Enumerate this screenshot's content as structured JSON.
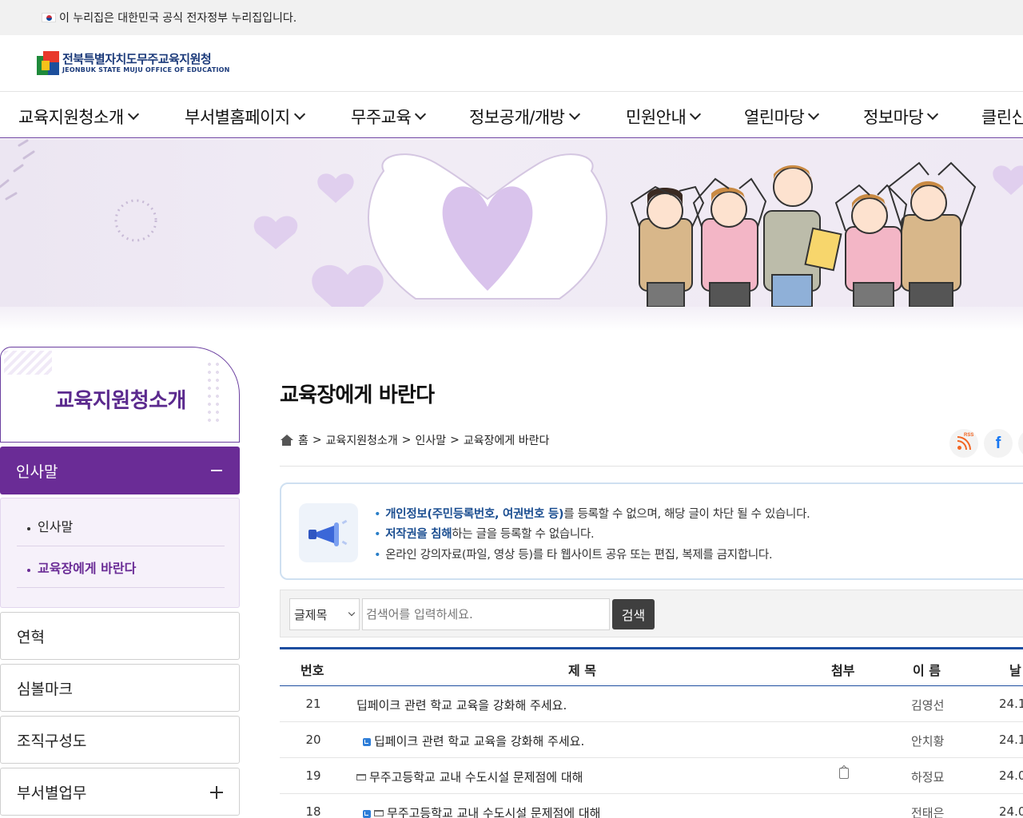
{
  "gov_banner": {
    "text": "이 누리집은 대한민국 공식 전자정부 누리집입니다."
  },
  "logo": {
    "name_ko": "전북특별자치도무주교육지원청",
    "name_en": "JEONBUK STATE MUJU OFFICE OF EDUCATION"
  },
  "gnb": [
    "교육지원청소개",
    "부서별홈페이지",
    "무주교육",
    "정보공개/개방",
    "민원안내",
    "열린마당",
    "정보마당",
    "클린신"
  ],
  "sidebar": {
    "title": "교육지원청소개",
    "active": "인사말",
    "sub_items": [
      "인사말",
      "교육장에게 바란다"
    ],
    "items": [
      "연혁",
      "심볼마크",
      "조직구성도",
      "부서별업무"
    ]
  },
  "page": {
    "title": "교육장에게 바란다",
    "breadcrumb": [
      "홈",
      "교육지원청소개",
      "인사말",
      "교육장에게 바란다"
    ],
    "share": {
      "rss_label": "RSS",
      "facebook": "f"
    }
  },
  "notice": {
    "line1_hl": "개인정보(주민등록번호, 여권번호 등)",
    "line1_rest": "를 등록할 수 없으며, 해당 글이 차단 될 수 있습니다.",
    "line2_hl": "저작권을 침해",
    "line2_rest": "하는 글을 등록할 수 없습니다.",
    "line3": "온라인 강의자료(파일, 영상 등)를 타 웹사이트 공유 또는 편집, 복제를 금지합니다."
  },
  "search": {
    "select_value": "글제목",
    "placeholder": "검색어를 입력하세요.",
    "button": "검색"
  },
  "table": {
    "headers": [
      "번호",
      "제 목",
      "첨부",
      "이 름",
      "날"
    ],
    "rows": [
      {
        "num": "21",
        "title": "딥페이크 관련 학교 교육을 강화해 주세요.",
        "name": "김영선",
        "date": "24.1"
      },
      {
        "num": "20",
        "title": "딥페이크 관련 학교 교육을 강화해 주세요.",
        "name": "안치황",
        "date": "24.1"
      },
      {
        "num": "19",
        "title": "무주고등학교 교내 수도시설 문제점에 대해",
        "name": "하정묘",
        "date": "24.0"
      },
      {
        "num": "18",
        "title": "무주고등학교 교내 수도시설 문제점에 대해",
        "name": "전태은",
        "date": "24.0"
      }
    ]
  }
}
